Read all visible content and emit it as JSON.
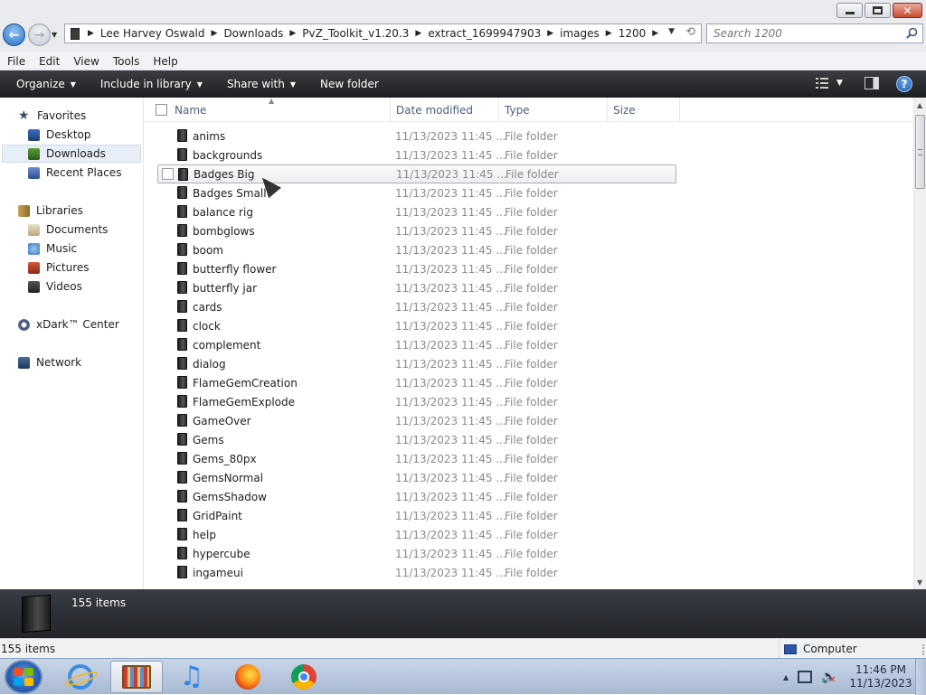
{
  "window": {
    "controls": {
      "minimize": "minimize-icon",
      "maximize": "maximize-icon",
      "close": "close-icon"
    }
  },
  "address": {
    "breadcrumbs": [
      "Lee Harvey Oswald",
      "Downloads",
      "PvZ_Toolkit_v1.20.3",
      "extract_1699947903",
      "images",
      "1200"
    ],
    "search_placeholder": "Search 1200"
  },
  "menubar": {
    "items": [
      "File",
      "Edit",
      "View",
      "Tools",
      "Help"
    ]
  },
  "commandbar": {
    "organize": "Organize",
    "include_in_library": "Include in library",
    "share_with": "Share with",
    "new_folder": "New folder"
  },
  "navpane": {
    "favorites": {
      "header": "Favorites",
      "items": [
        "Desktop",
        "Downloads",
        "Recent Places"
      ],
      "selected": "Downloads"
    },
    "libraries": {
      "header": "Libraries",
      "items": [
        "Documents",
        "Music",
        "Pictures",
        "Videos"
      ]
    },
    "xdark": "xDark™ Center",
    "network": "Network"
  },
  "columns": {
    "name": "Name",
    "date": "Date modified",
    "type": "Type",
    "size": "Size"
  },
  "files": [
    {
      "name": "anims",
      "date": "11/13/2023 11:45 ...",
      "type": "File folder"
    },
    {
      "name": "backgrounds",
      "date": "11/13/2023 11:45 ...",
      "type": "File folder"
    },
    {
      "name": "Badges Big",
      "date": "11/13/2023 11:45 ...",
      "type": "File folder"
    },
    {
      "name": "Badges Small",
      "date": "11/13/2023 11:45 ...",
      "type": "File folder"
    },
    {
      "name": "balance rig",
      "date": "11/13/2023 11:45 ...",
      "type": "File folder"
    },
    {
      "name": "bombglows",
      "date": "11/13/2023 11:45 ...",
      "type": "File folder"
    },
    {
      "name": "boom",
      "date": "11/13/2023 11:45 ...",
      "type": "File folder"
    },
    {
      "name": "butterfly flower",
      "date": "11/13/2023 11:45 ...",
      "type": "File folder"
    },
    {
      "name": "butterfly jar",
      "date": "11/13/2023 11:45 ...",
      "type": "File folder"
    },
    {
      "name": "cards",
      "date": "11/13/2023 11:45 ...",
      "type": "File folder"
    },
    {
      "name": "clock",
      "date": "11/13/2023 11:45 ...",
      "type": "File folder"
    },
    {
      "name": "complement",
      "date": "11/13/2023 11:45 ...",
      "type": "File folder"
    },
    {
      "name": "dialog",
      "date": "11/13/2023 11:45 ...",
      "type": "File folder"
    },
    {
      "name": "FlameGemCreation",
      "date": "11/13/2023 11:45 ...",
      "type": "File folder"
    },
    {
      "name": "FlameGemExplode",
      "date": "11/13/2023 11:45 ...",
      "type": "File folder"
    },
    {
      "name": "GameOver",
      "date": "11/13/2023 11:45 ...",
      "type": "File folder"
    },
    {
      "name": "Gems",
      "date": "11/13/2023 11:45 ...",
      "type": "File folder"
    },
    {
      "name": "Gems_80px",
      "date": "11/13/2023 11:45 ...",
      "type": "File folder"
    },
    {
      "name": "GemsNormal",
      "date": "11/13/2023 11:45 ...",
      "type": "File folder"
    },
    {
      "name": "GemsShadow",
      "date": "11/13/2023 11:45 ...",
      "type": "File folder"
    },
    {
      "name": "GridPaint",
      "date": "11/13/2023 11:45 ...",
      "type": "File folder"
    },
    {
      "name": "help",
      "date": "11/13/2023 11:45 ...",
      "type": "File folder"
    },
    {
      "name": "hypercube",
      "date": "11/13/2023 11:45 ...",
      "type": "File folder"
    },
    {
      "name": "ingameui",
      "date": "11/13/2023 11:45 ...",
      "type": "File folder"
    }
  ],
  "hovered_file": "Badges Big",
  "details": {
    "count": "155 items"
  },
  "status": {
    "count": "155 items",
    "zone": "Computer"
  },
  "taskbar": {
    "apps": [
      "internet-explorer-icon",
      "windows-explorer-icon",
      "music-player-icon",
      "firefox-icon",
      "chrome-icon"
    ],
    "time": "11:46 PM",
    "date": "11/13/2023"
  }
}
